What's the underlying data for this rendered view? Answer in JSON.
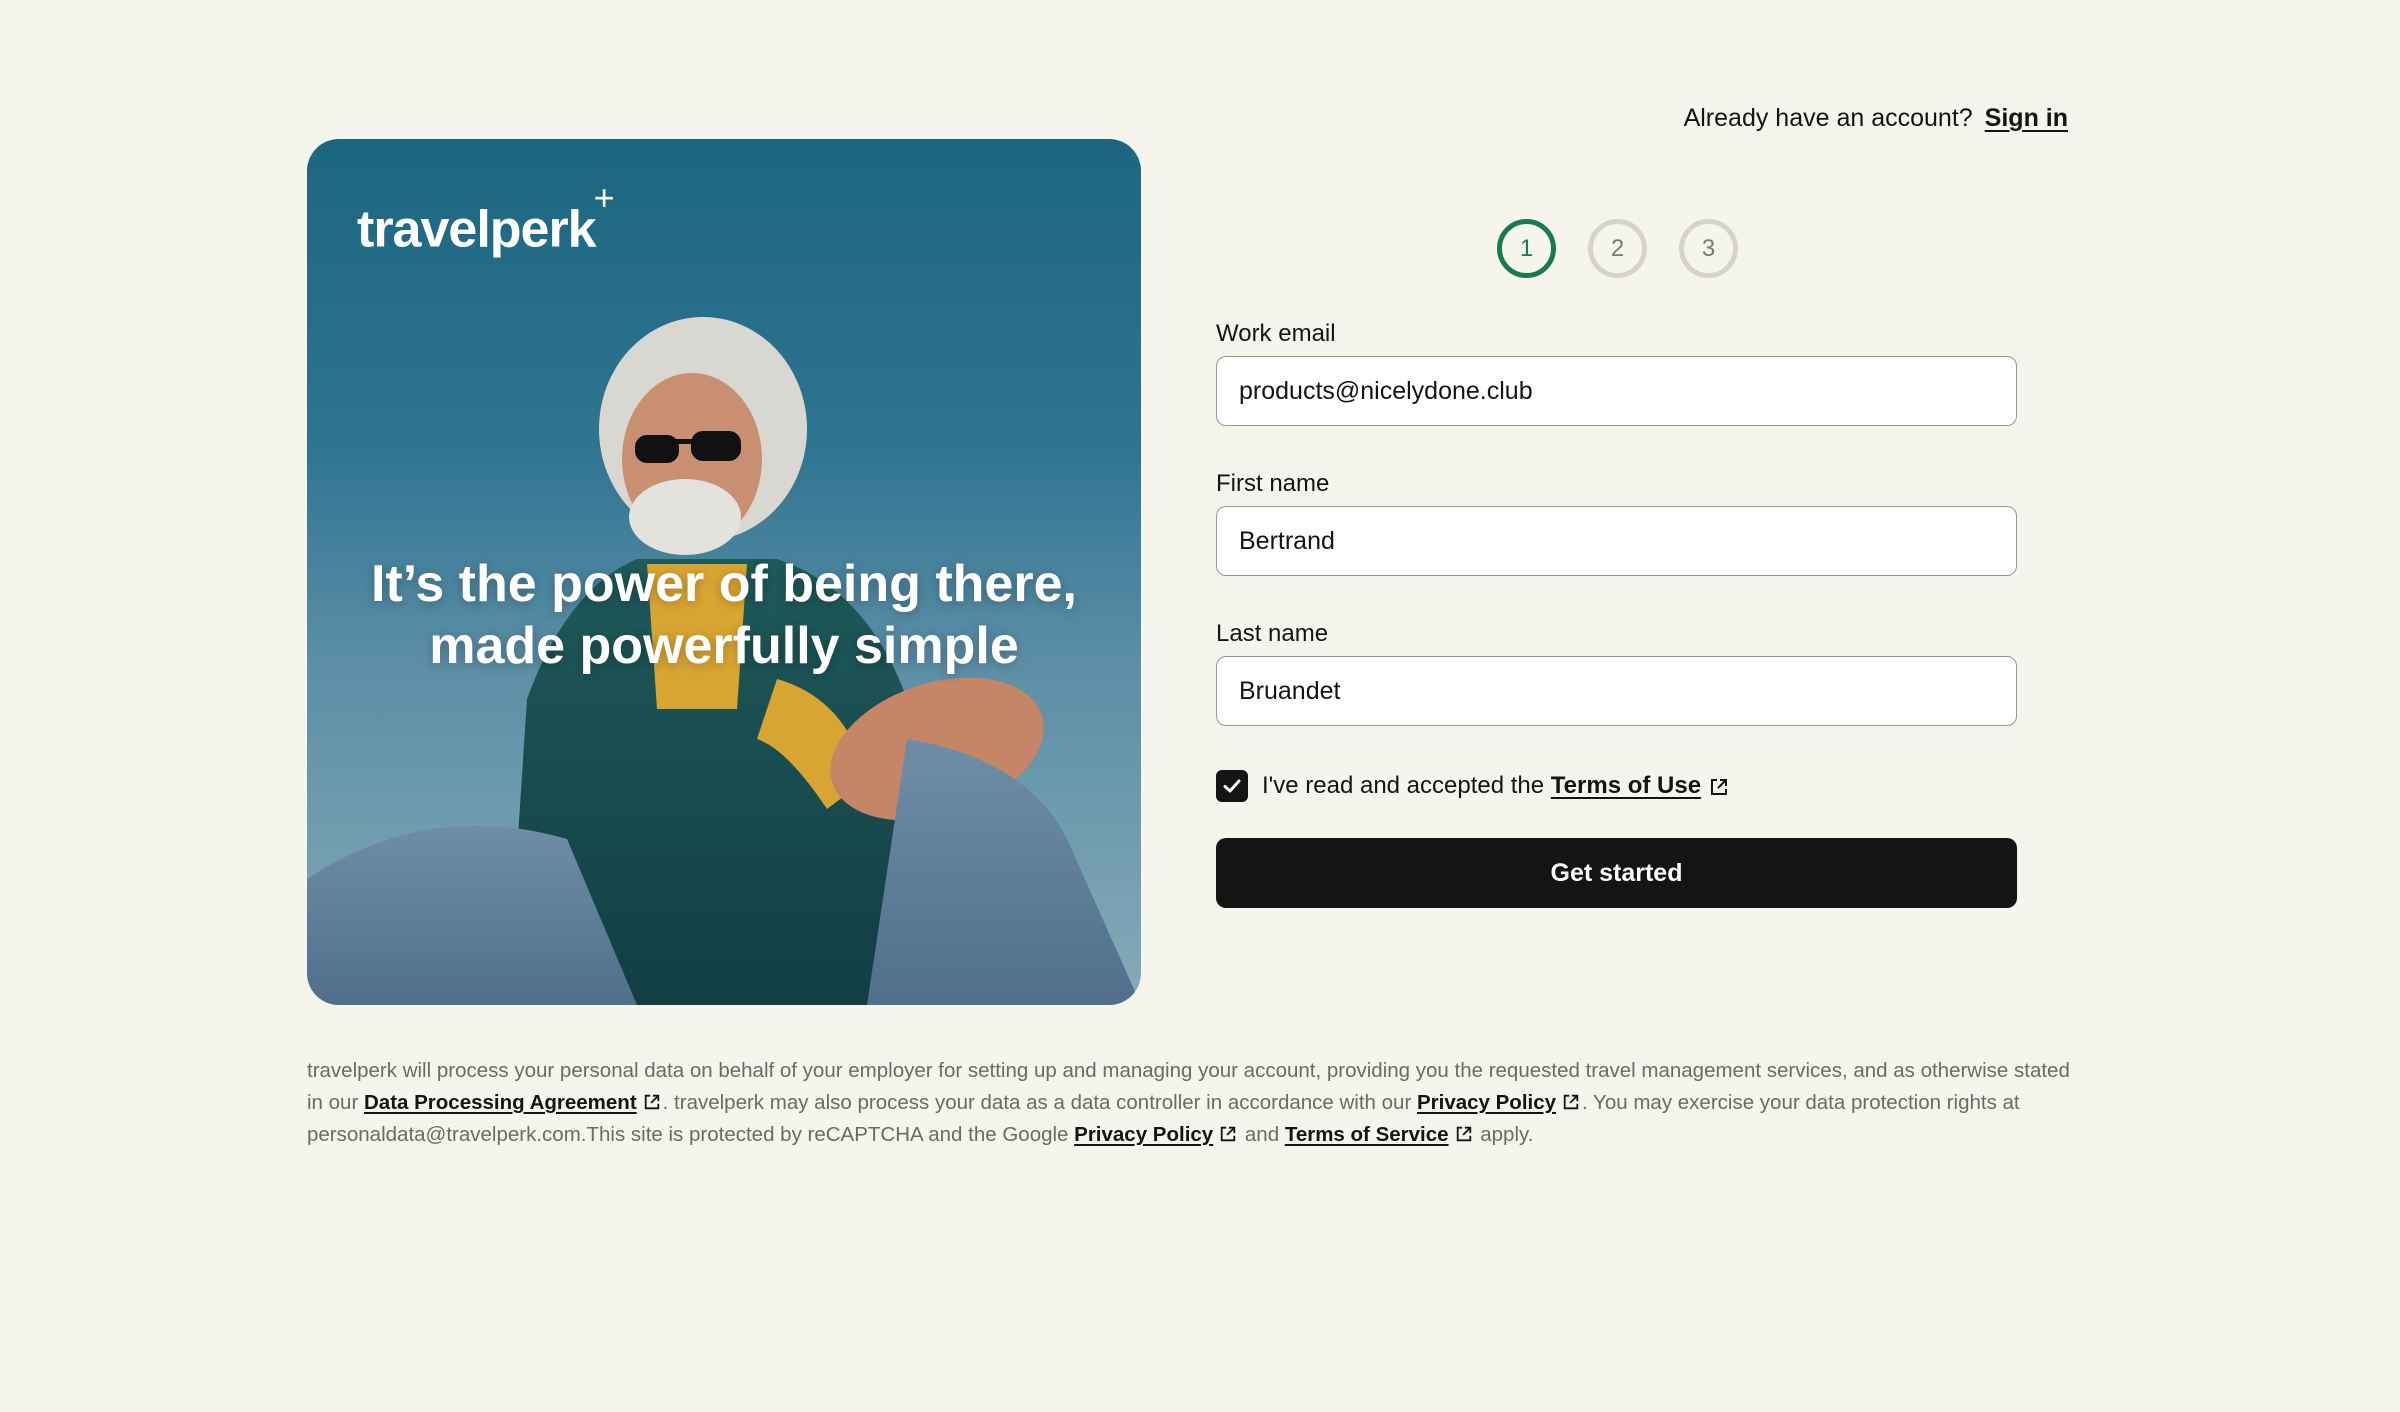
{
  "header": {
    "signin_prompt": "Already have an account?",
    "signin_link": "Sign in"
  },
  "hero": {
    "logo_text": "travelperk",
    "logo_mark": "+",
    "headline_line1": "It’s the power of being there,",
    "headline_line2": "made powerfully simple"
  },
  "stepper": {
    "steps": [
      "1",
      "2",
      "3"
    ],
    "active_step": 1
  },
  "form": {
    "email_label": "Work email",
    "email_value": "products@nicelydone.club",
    "first_name_label": "First name",
    "first_name_value": "Bertrand",
    "last_name_label": "Last name",
    "last_name_value": "Bruandet",
    "terms_text": "I've read and accepted the",
    "terms_link": "Terms of Use",
    "terms_checked": true,
    "submit_label": "Get started"
  },
  "legal": {
    "part1": "travelperk will process your personal data on behalf of your employer for setting up and managing your account, providing you the requested travel management services, and as otherwise stated in our",
    "dpa_link": "Data Processing Agreement",
    "part2": ". travelperk may also process your data as a data controller in accordance with our",
    "privacy_link": "Privacy Policy",
    "part3": ". You may exercise your data protection rights at personaldata@travelperk.com.This site is protected by reCAPTCHA and the Google",
    "google_privacy_link": "Privacy Policy",
    "part4": "and",
    "google_terms_link": "Terms of Service",
    "part5": "apply."
  },
  "colors": {
    "background": "#f5f4ed",
    "accent_green": "#1a7a4c",
    "button_dark": "#141414",
    "hero_teal": "#1b6680"
  },
  "icons": [
    "external-link-icon",
    "checkmark-icon"
  ]
}
